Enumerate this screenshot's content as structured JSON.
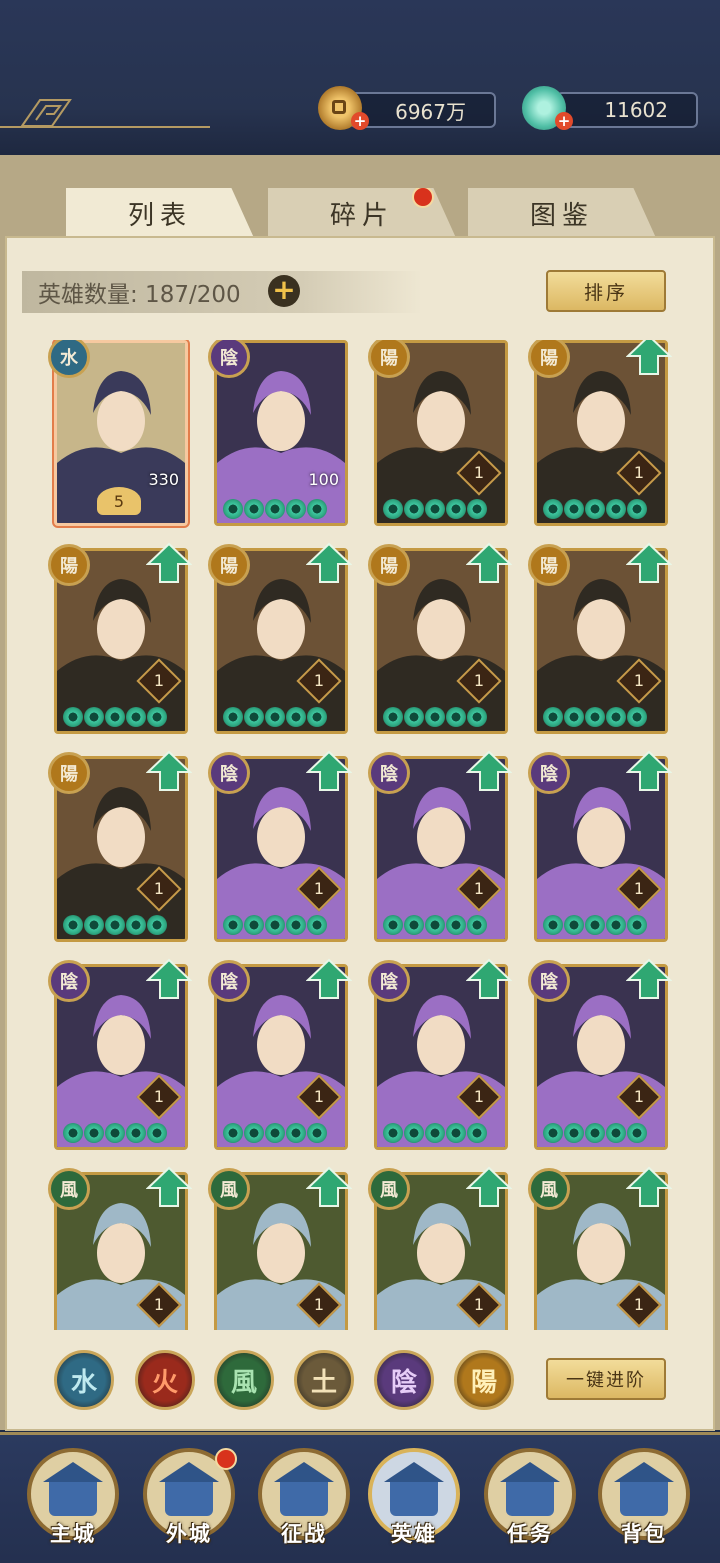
{
  "currency": {
    "coins": "6967万",
    "jade": "11602"
  },
  "tabs": [
    {
      "label": "列表",
      "active": true
    },
    {
      "label": "碎片",
      "active": false,
      "has_dot": true
    },
    {
      "label": "图鉴",
      "active": false
    }
  ],
  "hero_count": "英雄数量: 187/200",
  "sort_label": "排序",
  "heroes": [
    {
      "faction": "水",
      "level": "5",
      "power": "330",
      "stars": 0,
      "selected": true
    },
    {
      "faction": "陰",
      "level": "100",
      "stars": 5
    },
    {
      "faction": "陽",
      "level": "1",
      "stars": 5
    },
    {
      "faction": "陽",
      "level": "1",
      "stars": 5,
      "upgrade": true
    },
    {
      "faction": "陽",
      "level": "1",
      "stars": 5,
      "upgrade": true
    },
    {
      "faction": "陽",
      "level": "1",
      "stars": 5,
      "upgrade": true
    },
    {
      "faction": "陽",
      "level": "1",
      "stars": 5,
      "upgrade": true
    },
    {
      "faction": "陽",
      "level": "1",
      "stars": 5,
      "upgrade": true
    },
    {
      "faction": "陽",
      "level": "1",
      "stars": 5,
      "upgrade": true
    },
    {
      "faction": "陰",
      "level": "1",
      "stars": 5,
      "upgrade": true
    },
    {
      "faction": "陰",
      "level": "1",
      "stars": 5,
      "upgrade": true
    },
    {
      "faction": "陰",
      "level": "1",
      "stars": 5,
      "upgrade": true
    },
    {
      "faction": "陰",
      "level": "1",
      "stars": 5,
      "upgrade": true
    },
    {
      "faction": "陰",
      "level": "1",
      "stars": 5,
      "upgrade": true
    },
    {
      "faction": "陰",
      "level": "1",
      "stars": 5,
      "upgrade": true
    },
    {
      "faction": "陰",
      "level": "1",
      "stars": 5,
      "upgrade": true
    },
    {
      "faction": "風",
      "level": "1",
      "stars": 0,
      "upgrade": true
    },
    {
      "faction": "風",
      "level": "1",
      "stars": 0,
      "upgrade": true
    },
    {
      "faction": "風",
      "level": "1",
      "stars": 0,
      "upgrade": true
    },
    {
      "faction": "風",
      "level": "1",
      "stars": 0,
      "upgrade": true
    }
  ],
  "element_filters": [
    "水",
    "火",
    "風",
    "土",
    "陰",
    "陽"
  ],
  "one_key_advance": "一键进阶",
  "nav": [
    {
      "label": "主城",
      "icon": "castle-icon"
    },
    {
      "label": "外城",
      "icon": "city-gate-icon",
      "has_dot": true
    },
    {
      "label": "征战",
      "icon": "battle-icon"
    },
    {
      "label": "英雄",
      "icon": "hero-icon",
      "active": true
    },
    {
      "label": "任务",
      "icon": "quest-icon"
    },
    {
      "label": "背包",
      "icon": "bag-icon"
    }
  ],
  "colors": {
    "water": "#2f6a84",
    "fire": "#9a2a1c",
    "wind": "#2e6a3b",
    "earth": "#6b5a3a",
    "yin": "#5a3a7c",
    "yang": "#b0781c",
    "accent_gold": "#c49a43",
    "panel": "#eee7d2",
    "topbar": "#27334f"
  }
}
